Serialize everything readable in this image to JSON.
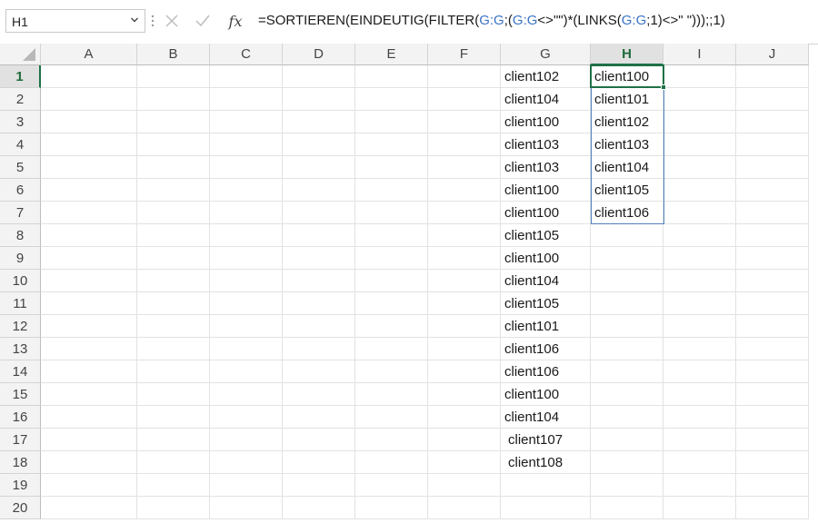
{
  "name_box": {
    "value": "H1"
  },
  "formula_bar": {
    "fx_label": "fx",
    "segments": [
      {
        "text": "=SORTIEREN(EINDEUTIG(FILTER(",
        "ref": false
      },
      {
        "text": "G:G",
        "ref": true
      },
      {
        "text": ";(",
        "ref": false
      },
      {
        "text": "G:G",
        "ref": true
      },
      {
        "text": "<>\"\")*(LINKS(",
        "ref": false
      },
      {
        "text": "G:G",
        "ref": true
      },
      {
        "text": ";1)<>\" \")));;1)",
        "ref": false
      }
    ]
  },
  "columns": [
    "A",
    "B",
    "C",
    "D",
    "E",
    "F",
    "G",
    "H",
    "I",
    "J"
  ],
  "rows": [
    "1",
    "2",
    "3",
    "4",
    "5",
    "6",
    "7",
    "8",
    "9",
    "10",
    "11",
    "12",
    "13",
    "14",
    "15",
    "16",
    "17",
    "18",
    "19",
    "20"
  ],
  "selected": {
    "column": "H",
    "row": "1"
  },
  "column_g": [
    "client102",
    "client104",
    "client100",
    "client103",
    "client103",
    "client100",
    "client100",
    "client105",
    "client100",
    "client104",
    "client105",
    "client101",
    "client106",
    "client106",
    "client100",
    "client104",
    "client107",
    "client108",
    "",
    ""
  ],
  "column_h": [
    "client100",
    "client101",
    "client102",
    "client103",
    "client104",
    "client105",
    "client106",
    "",
    "",
    "",
    "",
    "",
    "",
    "",
    "",
    "",
    "",
    "",
    "",
    ""
  ],
  "colors": {
    "selection": "#1e7145",
    "spill_border": "#4f81bd",
    "reference": "#3b73c4"
  },
  "icons": {
    "cancel": "close-icon",
    "enter": "check-icon",
    "namebox_dropdown": "chevron-down-icon"
  }
}
